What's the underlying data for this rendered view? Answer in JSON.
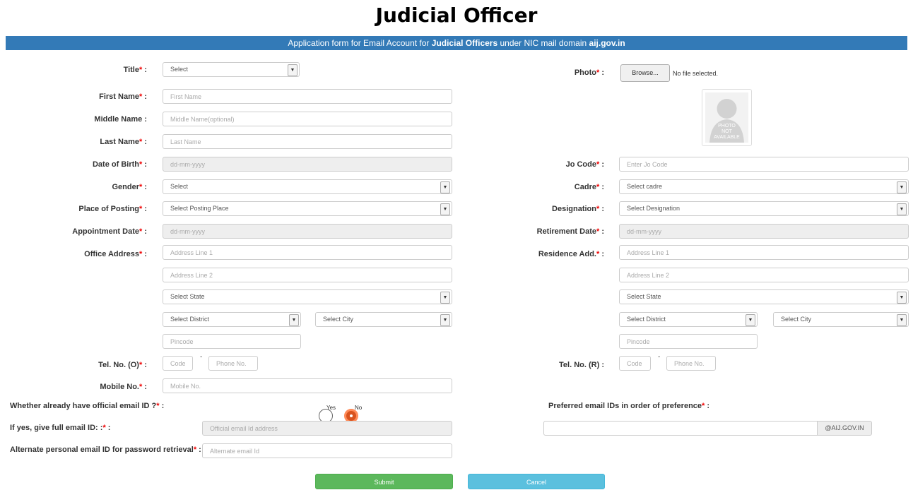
{
  "page_title": "Judicial Officer",
  "banner": {
    "prefix": "Application form for Email Account for ",
    "bold1": "Judicial Officers",
    "middle": " under NIC mail domain ",
    "bold2": "aij.gov.in"
  },
  "labels": {
    "title": "Title",
    "photo": "Photo",
    "first_name": "First Name",
    "middle_name": "Middle Name :",
    "last_name": "Last Name",
    "dob": "Date of Birth",
    "jo_code": "Jo Code",
    "gender": "Gender",
    "cadre": "Cadre",
    "posting": "Place of Posting",
    "designation": "Designation",
    "appointment": "Appointment Date",
    "retirement": "Retirement Date",
    "office_address": "Office Address",
    "residence_address": "Residence Add.",
    "tel_o": "Tel. No. (O)",
    "tel_r": "Tel. No. (R) :",
    "mobile": "Mobile No.",
    "already_email": "Whether already have official email ID ?",
    "preferred": "Preferred email IDs in order of preference",
    "give_email": "If yes, give full email ID:",
    "alternate": "Alternate personal email ID for password retrieval",
    "req_mark": "*",
    "colon": " :"
  },
  "fields": {
    "title_select": "Select",
    "browse_button": "Browse...",
    "file_status": "No file selected.",
    "photo_text": [
      "PHOTO",
      "NOT",
      "AVAILABLE"
    ],
    "first_name_ph": "First Name",
    "middle_name_ph": "Middle Name(optional)",
    "last_name_ph": "Last Name",
    "dob_ph": "dd-mm-yyyy",
    "jo_code_ph": "Enter Jo Code",
    "gender_select": "Select",
    "cadre_select": "Select cadre",
    "posting_select": "Select Posting Place",
    "designation_select": "Select Designation",
    "appointment_ph": "dd-mm-yyyy",
    "retirement_ph": "dd-mm-yyyy",
    "office_addr1_ph": "Address Line 1",
    "office_addr2_ph": "Address Line 2",
    "office_state": "Select State",
    "office_district": "Select District",
    "office_city": "Select City",
    "office_pincode_ph": "Pincode",
    "res_addr1_ph": "Address Line 1",
    "res_addr2_ph": "Address Line 2",
    "res_state": "Select State",
    "res_district": "Select District",
    "res_city": "Select City",
    "res_pincode_ph": "Pincode",
    "tel_o_code_ph": "Code",
    "tel_o_phone_ph": "Phone No.",
    "tel_r_code_ph": "Code",
    "tel_r_phone_ph": "Phone No.",
    "tel_dash": "-",
    "mobile_ph": "Mobile No.",
    "radio_yes": "Yes",
    "radio_no": "No",
    "radio_selected": "No",
    "official_email_ph": "Official email Id address",
    "preferred_email_ph": "",
    "domain_suffix": "@AIJ.GOV.IN",
    "alternate_email_ph": "Alternate email Id"
  },
  "buttons": {
    "submit": "Submit",
    "cancel": "Cancel"
  },
  "colors": {
    "banner": "#337ab7",
    "required": "#ee0000",
    "submit": "#5cb85c",
    "cancel": "#5bc0de",
    "radio_selected": "#d9531e"
  }
}
